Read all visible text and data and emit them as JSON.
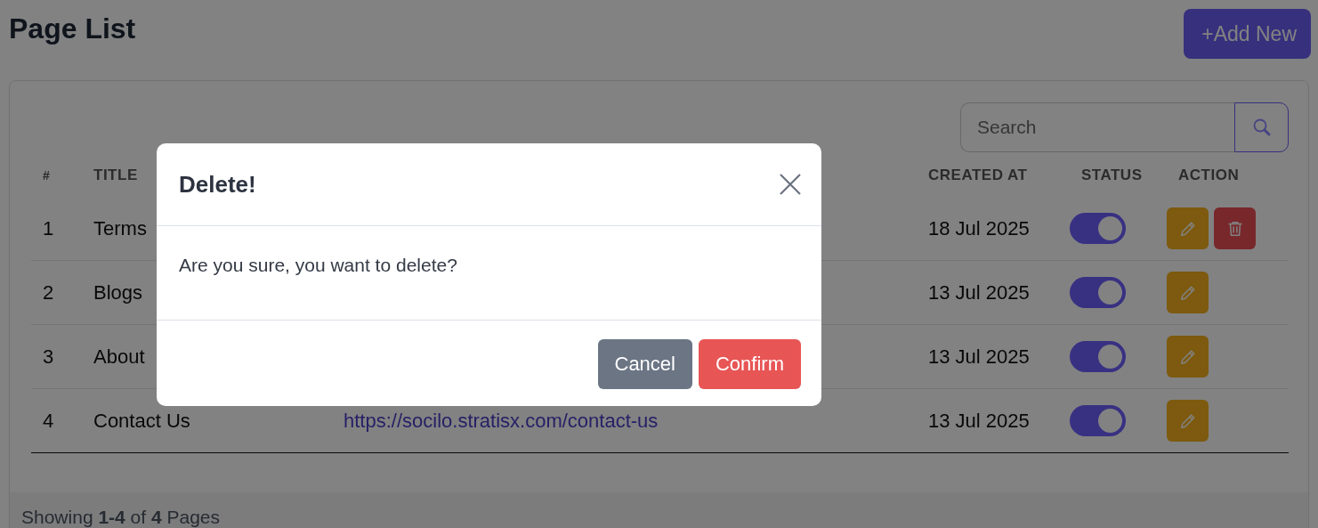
{
  "page": {
    "title": "Page List",
    "add_button": {
      "icon": "+",
      "label": "Add New"
    }
  },
  "search": {
    "placeholder": "Search"
  },
  "table": {
    "columns": [
      {
        "label": "#",
        "kind": "index"
      },
      {
        "label": "TITLE",
        "kind": "title"
      },
      {
        "label": "CREATED AT",
        "kind": "created"
      },
      {
        "label": "STATUS",
        "kind": "status"
      },
      {
        "label": "ACTION",
        "kind": "action"
      }
    ],
    "rows": [
      {
        "number": "1",
        "title": "Terms",
        "created_at": "18 Jul 2025",
        "status_on": true,
        "can_delete": true
      },
      {
        "number": "2",
        "title": "Blogs",
        "created_at": "13 Jul 2025",
        "status_on": true,
        "can_delete": false
      },
      {
        "number": "3",
        "title": "About",
        "created_at": "13 Jul 2025",
        "status_on": true,
        "can_delete": false
      },
      {
        "number": "4",
        "title": "Contact Us",
        "url": "https://socilo.stratisx.com/contact-us",
        "created_at": "13 Jul 2025",
        "status_on": true,
        "can_delete": false
      }
    ]
  },
  "footer": {
    "summary": "Showing **1-4** of **4** Pages"
  },
  "modal": {
    "title": "Delete!",
    "message": "Are you sure, you want to delete?",
    "buttons": [
      {
        "label": "Cancel",
        "kind": "secondary"
      },
      {
        "label": "Confirm",
        "kind": "danger"
      }
    ]
  }
}
